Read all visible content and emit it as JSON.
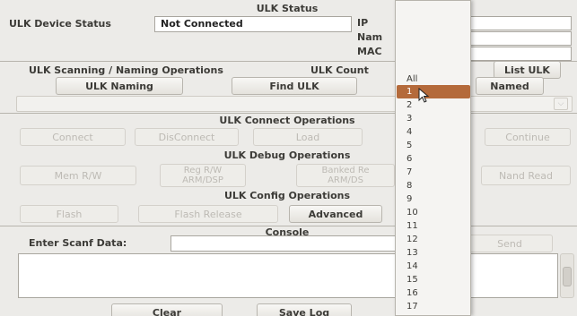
{
  "status": {
    "header": "ULK Status",
    "device_label": "ULK Device Status",
    "device_value": "Not Connected",
    "ip_label": "IP",
    "name_label": "Nam",
    "mac_label": "MAC"
  },
  "scanning": {
    "header": "ULK Scanning / Naming Operations",
    "count_label": "ULK Count",
    "list_button": "List ULK",
    "naming_button": "ULK Naming",
    "find_button": "Find ULK",
    "named_button": "Named"
  },
  "connect": {
    "header": "ULK Connect Operations",
    "connect": "Connect",
    "disconnect": "DisConnect",
    "load": "Load",
    "continue": "Continue"
  },
  "debug": {
    "header": "ULK Debug Operations",
    "mem": "Mem R/W",
    "reg_1": "Reg R/W",
    "reg_2": "ARM/DSP",
    "banked_1": "Banked Re",
    "banked_2": "ARM/DS",
    "nand": "Nand Read"
  },
  "config": {
    "header": "ULK Config Operations",
    "flash": "Flash",
    "flash_release": "Flash Release",
    "advanced": "Advanced"
  },
  "console": {
    "header": "Console",
    "scanf_label": "Enter Scanf Data:",
    "send": "Send",
    "clear": "Clear",
    "save_log": "Save Log"
  },
  "dropdown": {
    "selected": "1",
    "items": [
      "All",
      "1",
      "2",
      "3",
      "4",
      "5",
      "6",
      "7",
      "8",
      "9",
      "10",
      "11",
      "12",
      "13",
      "14",
      "15",
      "16",
      "17"
    ]
  }
}
